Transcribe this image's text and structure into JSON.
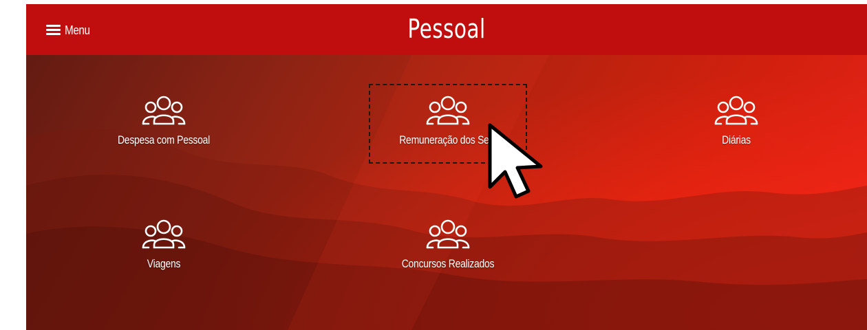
{
  "header": {
    "menu_label": "Menu",
    "title": "Pessoal",
    "background_color": "#c00d0d"
  },
  "tiles": [
    {
      "label": "Despesa com Pessoal",
      "icon": "people-group-icon"
    },
    {
      "label": "Remuneração dos Serv",
      "icon": "people-group-icon"
    },
    {
      "label": "Diárias",
      "icon": "people-group-icon"
    },
    {
      "label": "Viagens",
      "icon": "people-group-icon"
    },
    {
      "label": "Concursos Realizados",
      "icon": "people-group-icon"
    }
  ],
  "hover_state": {
    "hovered_tile": "Remuneração dos Serv",
    "cursor": "arrow-cursor-icon"
  },
  "theme": {
    "accent": "#c00d0d",
    "text": "#ffffff"
  }
}
